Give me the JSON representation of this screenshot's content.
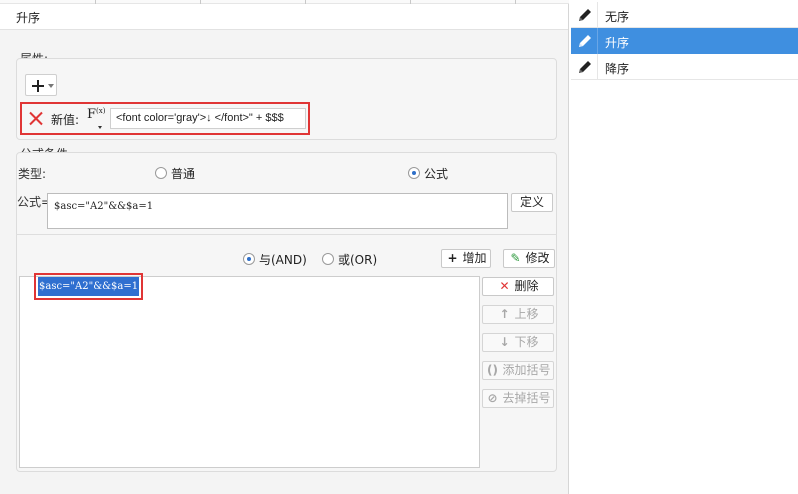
{
  "dialog": {
    "title": "升序",
    "property_section": "属性:",
    "value_label": "新值:",
    "fx_label": "F",
    "fx_sub": "(x)",
    "value_expression": "<font color='gray'>↓ </font>\" + $$$",
    "condition_section": "公式条件",
    "type_label": "类型:",
    "type_options": [
      "普通",
      "公式"
    ],
    "type_selected": "公式",
    "formula_label": "公式=",
    "formula_value": "$asc=\"A2\"&&$a=1",
    "define_button": "定义",
    "logic_options": [
      "与(AND)",
      "或(OR)"
    ],
    "logic_selected": "与(AND)",
    "add_button": "增加",
    "modify_button": "修改",
    "delete_button": "删除",
    "move_up_button": "上移",
    "move_down_button": "下移",
    "add_bracket_button": "添加括号",
    "remove_bracket_button": "去掉括号",
    "conditions": [
      "$asc=\"A2\"&&$a=1"
    ]
  },
  "sort_list": {
    "items": [
      "无序",
      "升序",
      "降序"
    ],
    "selected": "升序",
    "item_icon": "pencil-icon"
  },
  "colors": {
    "highlight_border": "#e03535",
    "selection_blue": "#3f8fe0",
    "condition_blue": "#2f6fd0"
  }
}
